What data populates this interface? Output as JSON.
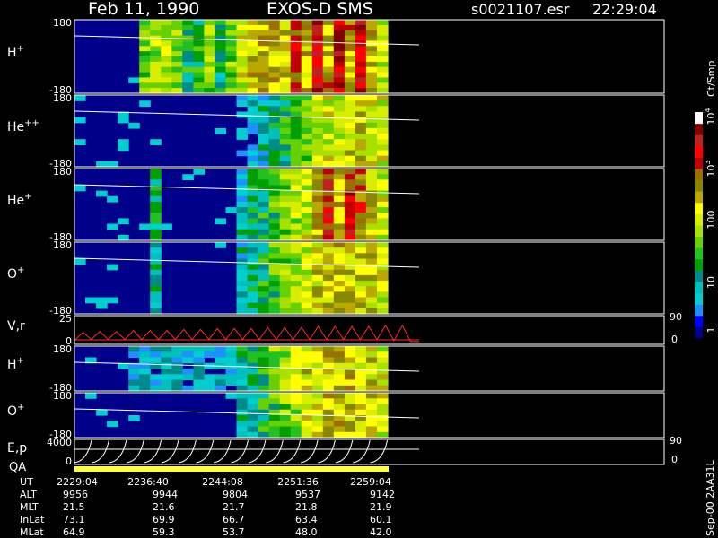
{
  "header": {
    "date": "Feb 11, 1990",
    "instrument": "EXOS-D SMS",
    "file": "s0021107.esr",
    "time": "22:29:04"
  },
  "colorbar": {
    "unit_label": "Ct/Smp",
    "tick_labels": [
      "1",
      "10",
      "100",
      "10",
      "10"
    ],
    "exponents": [
      "",
      "",
      "",
      "3",
      "4"
    ],
    "colors": [
      "#00008b",
      "#0000ff",
      "#1e90ff",
      "#00ced1",
      "#00bfbf",
      "#008b8b",
      "#00a000",
      "#22c022",
      "#66d000",
      "#a8e000",
      "#d8ee00",
      "#ffff00",
      "#b8a800",
      "#888800",
      "#9a7000",
      "#c00000",
      "#ff0000",
      "#c02020",
      "#800000",
      "#ffffff"
    ]
  },
  "chart_data": [
    {
      "type": "heatmap",
      "panel_label": "H",
      "superscript": "+",
      "y_ticks": [
        "180",
        "-180"
      ],
      "ylim": [
        -180,
        180
      ],
      "intensity_profile": [
        1,
        1,
        1,
        1,
        1,
        1,
        8,
        9,
        10,
        9,
        6,
        6,
        8,
        5,
        8,
        10,
        12,
        13,
        12,
        11,
        15,
        12,
        17,
        13,
        17,
        13,
        17,
        12,
        10
      ]
    },
    {
      "type": "heatmap",
      "panel_label": "He",
      "superscript": "++",
      "y_ticks": [
        "180",
        "-180"
      ],
      "ylim": [
        -180,
        180
      ],
      "intensity_profile": [
        1,
        1,
        1,
        1,
        1,
        1,
        1,
        1,
        1,
        1,
        1,
        1,
        1,
        1,
        1,
        2,
        3,
        4,
        5,
        6,
        7,
        8,
        9,
        10,
        10,
        11,
        11,
        10,
        10
      ]
    },
    {
      "type": "heatmap",
      "panel_label": "He",
      "superscript": "+",
      "y_ticks": [
        "180",
        "-180"
      ],
      "ylim": [
        -180,
        180
      ],
      "intensity_profile": [
        1,
        1,
        1,
        1,
        1,
        1,
        1,
        5,
        1,
        1,
        1,
        1,
        1,
        1,
        1,
        4,
        5,
        6,
        7,
        8,
        9,
        10,
        12,
        16,
        12,
        16,
        14,
        11,
        10
      ]
    },
    {
      "type": "heatmap",
      "panel_label": "O",
      "superscript": "+",
      "y_ticks": [
        "180",
        "-180"
      ],
      "ylim": [
        -180,
        180
      ],
      "intensity_profile": [
        1,
        1,
        1,
        1,
        1,
        1,
        1,
        5,
        1,
        1,
        1,
        1,
        1,
        1,
        1,
        4,
        5,
        6,
        7,
        8,
        9,
        10,
        11,
        12,
        12,
        12,
        11,
        11,
        10
      ]
    },
    {
      "type": "line",
      "panel_label": "V,r",
      "y_ticks_left": [
        "25",
        "0"
      ],
      "y_ticks_right": [
        "90",
        "0"
      ],
      "ylim": [
        0,
        25
      ],
      "series": [
        {
          "values": [
            2,
            10,
            3,
            11,
            3,
            11,
            3,
            12,
            3,
            12,
            3,
            12,
            3,
            13,
            3,
            13,
            3,
            14,
            3,
            14,
            3,
            14,
            3,
            15,
            3,
            15,
            3,
            15,
            3,
            16,
            3,
            16,
            3,
            16,
            3,
            16,
            3,
            17,
            2,
            17,
            1,
            1
          ]
        }
      ]
    },
    {
      "type": "heatmap",
      "panel_label": "H",
      "superscript": "+",
      "y_ticks": [
        "180",
        "-180"
      ],
      "ylim": [
        -180,
        180
      ],
      "intensity_profile": [
        1,
        1,
        1,
        1,
        1,
        3,
        4,
        3,
        4,
        3,
        3,
        4,
        3,
        3,
        3,
        5,
        6,
        7,
        8,
        9,
        10,
        11,
        11,
        12,
        12,
        12,
        11,
        11,
        10
      ]
    },
    {
      "type": "heatmap",
      "panel_label": "O",
      "superscript": "+",
      "y_ticks": [
        "180",
        "-180"
      ],
      "ylim": [
        -180,
        180
      ],
      "intensity_profile": [
        1,
        1,
        1,
        1,
        1,
        1,
        1,
        1,
        1,
        1,
        1,
        1,
        1,
        1,
        1,
        4,
        5,
        6,
        7,
        8,
        9,
        10,
        11,
        12,
        12,
        12,
        11,
        11,
        10
      ]
    },
    {
      "type": "line",
      "panel_label": "E,p",
      "y_ticks_left": [
        "4000",
        "0"
      ],
      "y_ticks_right": [
        "90",
        "0"
      ],
      "ylim": [
        0,
        4000
      ]
    }
  ],
  "qa_label": "QA",
  "footer": {
    "row_labels": [
      "UT",
      "ALT",
      "MLT",
      "InLat",
      "MLat"
    ],
    "columns": [
      [
        "2229:04",
        "9956",
        "21.5",
        "73.1",
        "64.9"
      ],
      [
        "2236:40",
        "9944",
        "21.6",
        "69.9",
        "59.3"
      ],
      [
        "2244:08",
        "9804",
        "21.7",
        "66.7",
        "53.7"
      ],
      [
        "2251:36",
        "9537",
        "21.8",
        "63.4",
        "48.0"
      ],
      [
        "2259:04",
        "9142",
        "21.9",
        "60.1",
        "42.0"
      ]
    ],
    "side_label": "Sep-00 2AA31L"
  }
}
